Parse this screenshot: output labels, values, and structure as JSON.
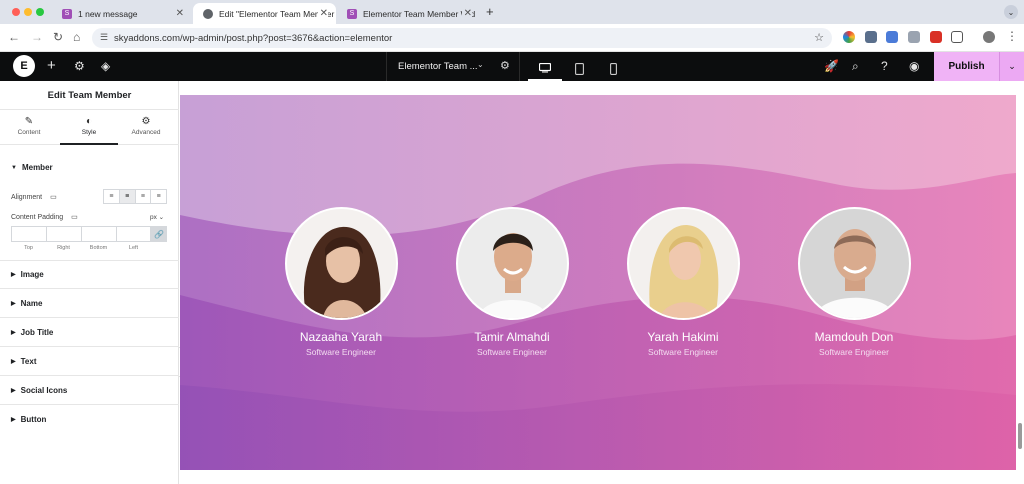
{
  "browser": {
    "tabs": [
      {
        "title": "1 new message",
        "favicon_color": "#a04fb6"
      },
      {
        "title": "Edit \"Elementor Team Member",
        "favicon_color": "#5f6368"
      },
      {
        "title": "Elementor Team Member Wid",
        "favicon_color": "#a04fb6"
      }
    ],
    "url": "skyaddons.com/wp-admin/post.php?post=3676&action=elementor"
  },
  "editor": {
    "document_title": "Elementor Team ...",
    "publish_label": "Publish"
  },
  "panel": {
    "title": "Edit Team Member",
    "tabs": [
      {
        "label": "Content",
        "icon": "pencil-icon"
      },
      {
        "label": "Style",
        "icon": "contrast-icon"
      },
      {
        "label": "Advanced",
        "icon": "gear-icon"
      }
    ],
    "member_section": "Member",
    "alignment_label": "Alignment",
    "content_padding_label": "Content Padding",
    "unit": "px",
    "padding_labels": [
      "Top",
      "Right",
      "Bottom",
      "Left"
    ],
    "sections": [
      "Image",
      "Name",
      "Job Title",
      "Text",
      "Social Icons",
      "Button"
    ]
  },
  "members": [
    {
      "name": "Nazaaha Yarah",
      "role": "Software Engineer"
    },
    {
      "name": "Tamir Almahdi",
      "role": "Software Engineer"
    },
    {
      "name": "Yarah Hakimi",
      "role": "Software Engineer"
    },
    {
      "name": "Mamdouh Don",
      "role": "Software Engineer"
    }
  ],
  "colors": {
    "publish": "#f0b3f6",
    "gradient_start": "#9b59b6",
    "gradient_end": "#e064a8"
  }
}
